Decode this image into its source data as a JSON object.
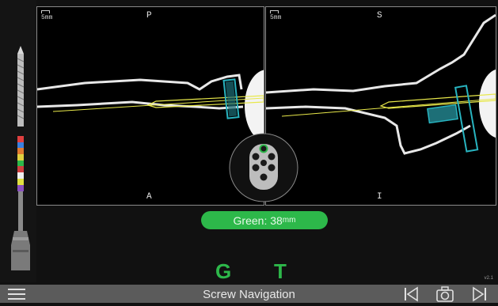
{
  "app": {
    "title": "Screw Navigation",
    "version": "v2.1"
  },
  "panels": [
    {
      "id": "left",
      "scale_label": "5mm",
      "top_label": "P",
      "bottom_label": "A"
    },
    {
      "id": "right",
      "scale_label": "5mm",
      "top_label": "S",
      "bottom_label": "I"
    }
  ],
  "screw": {
    "color_name": "Green",
    "length_value": "Green: 38",
    "length_unit": "mm",
    "color": "#2db84a"
  },
  "modes": {
    "left_letter": "G",
    "right_letter": "T"
  },
  "icons": {
    "menu": "hamburger-icon",
    "prev": "skip-back-icon",
    "camera": "camera-icon",
    "next": "skip-forward-icon"
  },
  "colors": {
    "accent": "#2db84a",
    "trajectory": "#e8e84a",
    "implant": "#28b4c0",
    "bottom_bar": "#5b5b5b",
    "background": "#111111"
  }
}
